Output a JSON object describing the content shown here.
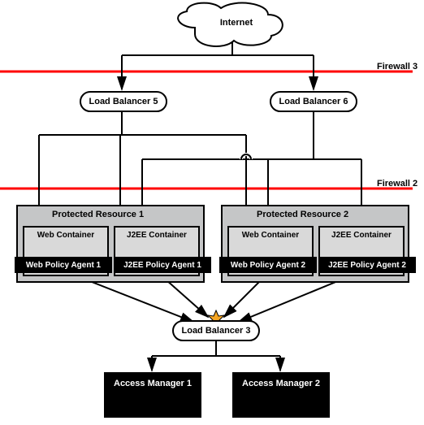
{
  "internet": "Internet",
  "firewalls": {
    "top": "Firewall 3",
    "mid": "Firewall 2"
  },
  "lb": {
    "left": "Load Balancer 5",
    "right": "Load Balancer 6",
    "bottom": "Load Balancer 3"
  },
  "pr1": {
    "title": "Protected Resource  1",
    "web_container": "Web Container",
    "j2ee_container": "J2EE Container",
    "web_agent": "Web Policy Agent 1",
    "j2ee_agent": "J2EE Policy Agent 1"
  },
  "pr2": {
    "title": "Protected Resource  2",
    "web_container": "Web Container",
    "j2ee_container": "J2EE Container",
    "web_agent": "Web Policy Agent 2",
    "j2ee_agent": "J2EE Policy Agent 2"
  },
  "am": {
    "one": "Access Manager 1",
    "two": "Access Manager 2"
  }
}
